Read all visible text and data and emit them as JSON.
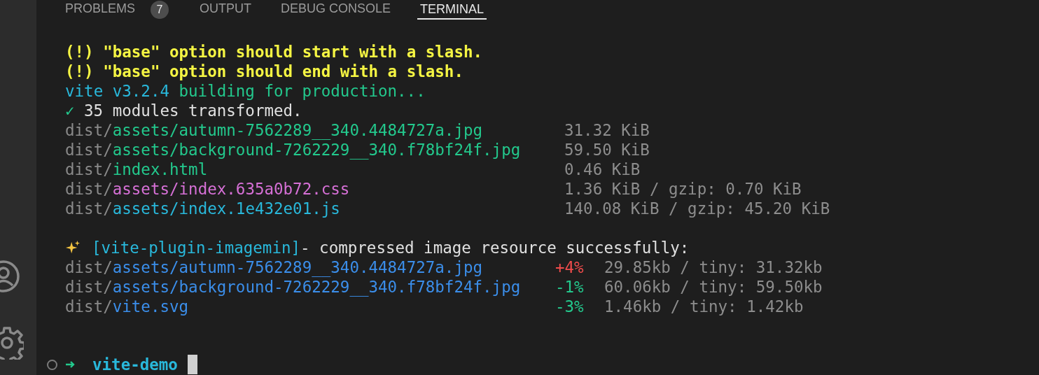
{
  "tabs": [
    {
      "label": "PROBLEMS",
      "badge": "7",
      "selected": false
    },
    {
      "label": "OUTPUT",
      "selected": false
    },
    {
      "label": "DEBUG CONSOLE",
      "selected": false
    },
    {
      "label": "TERMINAL",
      "selected": true
    }
  ],
  "terminal": {
    "lines": [
      {
        "kind": "text",
        "segments": [
          {
            "text": "(!) \"base\" option should start with a slash.",
            "color": "#f5f543"
          }
        ]
      },
      {
        "kind": "text",
        "segments": [
          {
            "text": "(!) \"base\" option should end with a slash.",
            "color": "#f5f543"
          }
        ]
      },
      {
        "kind": "text",
        "segments": [
          {
            "text": "vite v3.2.4",
            "color": "#29b8db"
          },
          {
            "text": "building for production...",
            "color": "#23c98d"
          }
        ]
      },
      {
        "kind": "text",
        "segments": [
          {
            "text": "✓",
            "color": "#23c98d"
          },
          {
            "text": "35 modules transformed.",
            "color": "#e0e0e0"
          }
        ]
      },
      {
        "kind": "file",
        "dir": "dist/",
        "path": "assets/autumn-7562289__340.4484727a.jpg",
        "color": "#23c98d",
        "size": "31.32 KiB"
      },
      {
        "kind": "file",
        "dir": "dist/",
        "path": "assets/background-7262229__340.f78bf24f.jpg",
        "color": "#23c98d",
        "size": "59.50 KiB"
      },
      {
        "kind": "file",
        "dir": "dist/",
        "path": "index.html",
        "color": "#23c98d",
        "size": "0.46 KiB"
      },
      {
        "kind": "file",
        "dir": "dist/",
        "path": "assets/index.635a0b72.css",
        "color": "#d670d6",
        "size": "1.36 KiB / gzip: 0.70 KiB"
      },
      {
        "kind": "file",
        "dir": "dist/",
        "path": "assets/index.1e432e01.js",
        "color": "#29b8db",
        "size": "140.08 KiB / gzip: 45.20 KiB"
      },
      {
        "kind": "blank"
      },
      {
        "kind": "plugin",
        "segments": [
          {
            "text": "[vite-plugin-imagemin]",
            "color": "#29b8db"
          },
          {
            "text": "- compressed image resource successfully:",
            "color": "#e0e0e0"
          }
        ]
      },
      {
        "kind": "compressed",
        "dir": "dist/",
        "path": "assets/autumn-7562289__340.4484727a.jpg",
        "color": "#3b8eea",
        "change": {
          "text": "+4%",
          "color": "#f14c4c"
        },
        "size": "29.85kb / tiny: 31.32kb"
      },
      {
        "kind": "compressed",
        "dir": "dist/",
        "path": "assets/background-7262229__340.f78bf24f.jpg",
        "color": "#3b8eea",
        "change": {
          "text": "-1%",
          "color": "#23c98d"
        },
        "size": "60.06kb / tiny: 59.50kb"
      },
      {
        "kind": "compressed",
        "dir": "dist/",
        "path": "vite.svg",
        "color": "#3b8eea",
        "change": {
          "text": "-3%",
          "color": "#23c98d"
        },
        "size": "1.46kb / tiny: 1.42kb"
      }
    ],
    "prompt": {
      "directory": "vite-demo"
    }
  }
}
